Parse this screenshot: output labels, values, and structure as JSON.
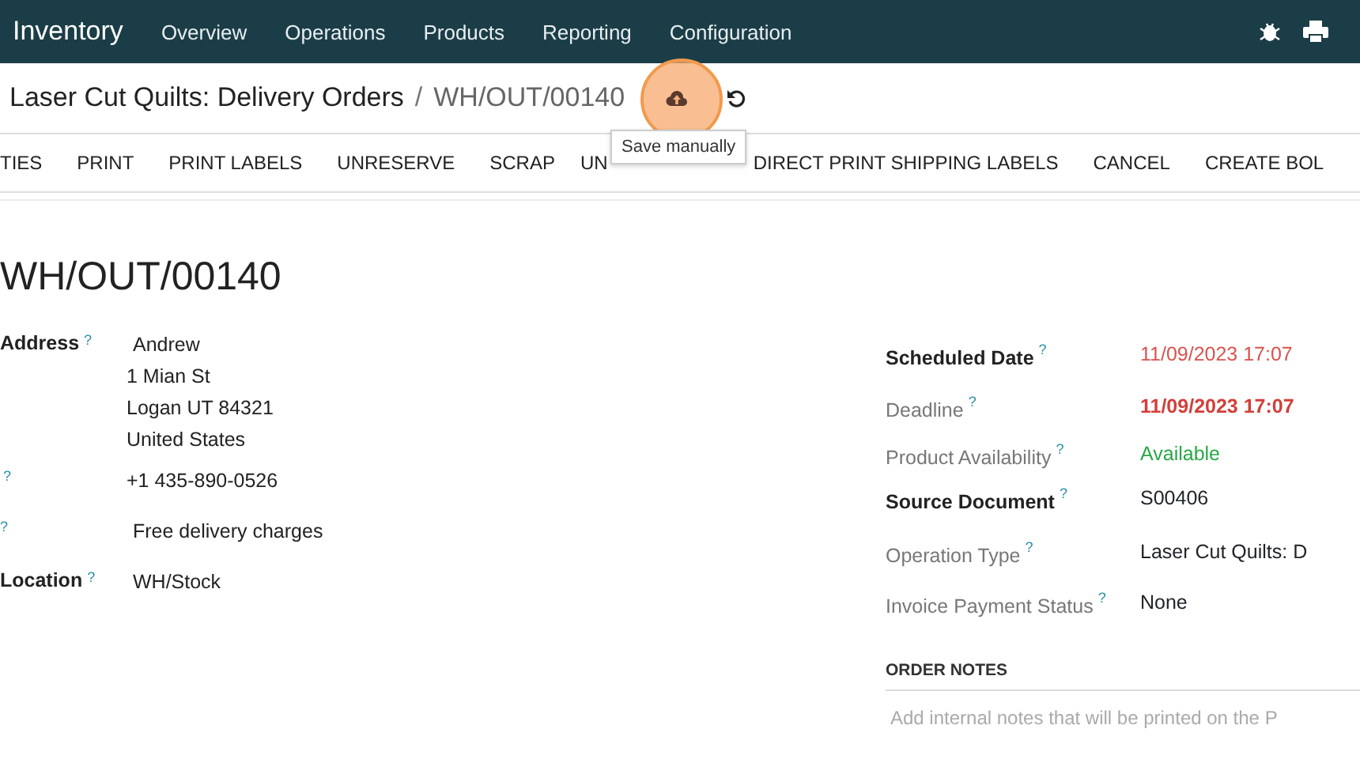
{
  "navbar": {
    "app": "Inventory",
    "menu": [
      "Overview",
      "Operations",
      "Products",
      "Reporting",
      "Configuration"
    ]
  },
  "breadcrumb": {
    "parent": "Laser Cut Quilts: Delivery Orders",
    "separator": "/",
    "current": "WH/OUT/00140",
    "tooltip": "Save manually"
  },
  "actions": [
    "TIES",
    "PRINT",
    "PRINT LABELS",
    "UNRESERVE",
    "SCRAP",
    "UN",
    "DIRECT PRINT SHIPPING LABELS",
    "CANCEL",
    "CREATE BOL"
  ],
  "title": "WH/OUT/00140",
  "left_fields": [
    {
      "label": "Address",
      "help": "?",
      "values": [
        "Andrew",
        "1 Mian St",
        "Logan UT 84321",
        "United States"
      ]
    },
    {
      "help": "?",
      "values": [
        "+1 435-890-0526"
      ]
    },
    {
      "help": "?",
      "values": [
        "Free delivery charges"
      ]
    },
    {
      "label": "Location",
      "help": "?",
      "values": [
        "WH/Stock"
      ]
    }
  ],
  "right_fields": [
    {
      "label": "Scheduled Date",
      "help": "?",
      "required": true,
      "value": "11/09/2023 17:07",
      "color": "#d9534f",
      "bold": false
    },
    {
      "label": "Deadline",
      "help": "?",
      "required": false,
      "value": "11/09/2023 17:07",
      "color": "#d23f3a",
      "bold": true
    },
    {
      "label": "Product Availability",
      "help": "?",
      "required": false,
      "value": "Available",
      "color": "#28a745",
      "bold": false
    },
    {
      "label": "Source Document",
      "help": "?",
      "required": true,
      "value": "S00406",
      "color": "#212529",
      "bold": false
    },
    {
      "label": "Operation Type",
      "help": "?",
      "required": false,
      "value": "Laser Cut Quilts: D",
      "color": "#212529",
      "bold": false
    },
    {
      "label": "Invoice Payment Status",
      "help": "?",
      "required": false,
      "value": "None",
      "color": "#212529",
      "bold": false
    }
  ],
  "notes": {
    "heading": "ORDER NOTES",
    "placeholder": "Add internal notes that will be printed on the P"
  }
}
